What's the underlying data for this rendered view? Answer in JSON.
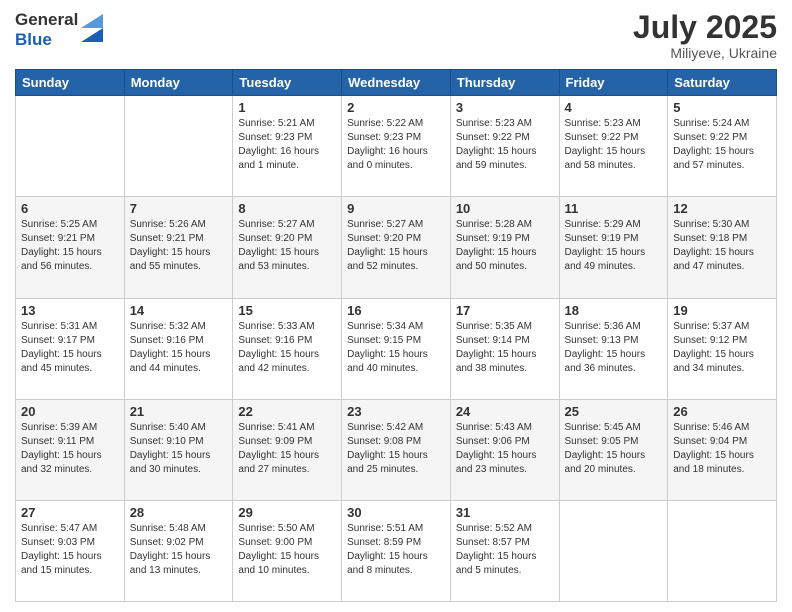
{
  "logo": {
    "general": "General",
    "blue": "Blue"
  },
  "title": "July 2025",
  "subtitle": "Miliyeve, Ukraine",
  "weekdays": [
    "Sunday",
    "Monday",
    "Tuesday",
    "Wednesday",
    "Thursday",
    "Friday",
    "Saturday"
  ],
  "weeks": [
    [
      {
        "day": "",
        "info": ""
      },
      {
        "day": "",
        "info": ""
      },
      {
        "day": "1",
        "info": "Sunrise: 5:21 AM\nSunset: 9:23 PM\nDaylight: 16 hours\nand 1 minute."
      },
      {
        "day": "2",
        "info": "Sunrise: 5:22 AM\nSunset: 9:23 PM\nDaylight: 16 hours\nand 0 minutes."
      },
      {
        "day": "3",
        "info": "Sunrise: 5:23 AM\nSunset: 9:22 PM\nDaylight: 15 hours\nand 59 minutes."
      },
      {
        "day": "4",
        "info": "Sunrise: 5:23 AM\nSunset: 9:22 PM\nDaylight: 15 hours\nand 58 minutes."
      },
      {
        "day": "5",
        "info": "Sunrise: 5:24 AM\nSunset: 9:22 PM\nDaylight: 15 hours\nand 57 minutes."
      }
    ],
    [
      {
        "day": "6",
        "info": "Sunrise: 5:25 AM\nSunset: 9:21 PM\nDaylight: 15 hours\nand 56 minutes."
      },
      {
        "day": "7",
        "info": "Sunrise: 5:26 AM\nSunset: 9:21 PM\nDaylight: 15 hours\nand 55 minutes."
      },
      {
        "day": "8",
        "info": "Sunrise: 5:27 AM\nSunset: 9:20 PM\nDaylight: 15 hours\nand 53 minutes."
      },
      {
        "day": "9",
        "info": "Sunrise: 5:27 AM\nSunset: 9:20 PM\nDaylight: 15 hours\nand 52 minutes."
      },
      {
        "day": "10",
        "info": "Sunrise: 5:28 AM\nSunset: 9:19 PM\nDaylight: 15 hours\nand 50 minutes."
      },
      {
        "day": "11",
        "info": "Sunrise: 5:29 AM\nSunset: 9:19 PM\nDaylight: 15 hours\nand 49 minutes."
      },
      {
        "day": "12",
        "info": "Sunrise: 5:30 AM\nSunset: 9:18 PM\nDaylight: 15 hours\nand 47 minutes."
      }
    ],
    [
      {
        "day": "13",
        "info": "Sunrise: 5:31 AM\nSunset: 9:17 PM\nDaylight: 15 hours\nand 45 minutes."
      },
      {
        "day": "14",
        "info": "Sunrise: 5:32 AM\nSunset: 9:16 PM\nDaylight: 15 hours\nand 44 minutes."
      },
      {
        "day": "15",
        "info": "Sunrise: 5:33 AM\nSunset: 9:16 PM\nDaylight: 15 hours\nand 42 minutes."
      },
      {
        "day": "16",
        "info": "Sunrise: 5:34 AM\nSunset: 9:15 PM\nDaylight: 15 hours\nand 40 minutes."
      },
      {
        "day": "17",
        "info": "Sunrise: 5:35 AM\nSunset: 9:14 PM\nDaylight: 15 hours\nand 38 minutes."
      },
      {
        "day": "18",
        "info": "Sunrise: 5:36 AM\nSunset: 9:13 PM\nDaylight: 15 hours\nand 36 minutes."
      },
      {
        "day": "19",
        "info": "Sunrise: 5:37 AM\nSunset: 9:12 PM\nDaylight: 15 hours\nand 34 minutes."
      }
    ],
    [
      {
        "day": "20",
        "info": "Sunrise: 5:39 AM\nSunset: 9:11 PM\nDaylight: 15 hours\nand 32 minutes."
      },
      {
        "day": "21",
        "info": "Sunrise: 5:40 AM\nSunset: 9:10 PM\nDaylight: 15 hours\nand 30 minutes."
      },
      {
        "day": "22",
        "info": "Sunrise: 5:41 AM\nSunset: 9:09 PM\nDaylight: 15 hours\nand 27 minutes."
      },
      {
        "day": "23",
        "info": "Sunrise: 5:42 AM\nSunset: 9:08 PM\nDaylight: 15 hours\nand 25 minutes."
      },
      {
        "day": "24",
        "info": "Sunrise: 5:43 AM\nSunset: 9:06 PM\nDaylight: 15 hours\nand 23 minutes."
      },
      {
        "day": "25",
        "info": "Sunrise: 5:45 AM\nSunset: 9:05 PM\nDaylight: 15 hours\nand 20 minutes."
      },
      {
        "day": "26",
        "info": "Sunrise: 5:46 AM\nSunset: 9:04 PM\nDaylight: 15 hours\nand 18 minutes."
      }
    ],
    [
      {
        "day": "27",
        "info": "Sunrise: 5:47 AM\nSunset: 9:03 PM\nDaylight: 15 hours\nand 15 minutes."
      },
      {
        "day": "28",
        "info": "Sunrise: 5:48 AM\nSunset: 9:02 PM\nDaylight: 15 hours\nand 13 minutes."
      },
      {
        "day": "29",
        "info": "Sunrise: 5:50 AM\nSunset: 9:00 PM\nDaylight: 15 hours\nand 10 minutes."
      },
      {
        "day": "30",
        "info": "Sunrise: 5:51 AM\nSunset: 8:59 PM\nDaylight: 15 hours\nand 8 minutes."
      },
      {
        "day": "31",
        "info": "Sunrise: 5:52 AM\nSunset: 8:57 PM\nDaylight: 15 hours\nand 5 minutes."
      },
      {
        "day": "",
        "info": ""
      },
      {
        "day": "",
        "info": ""
      }
    ]
  ]
}
